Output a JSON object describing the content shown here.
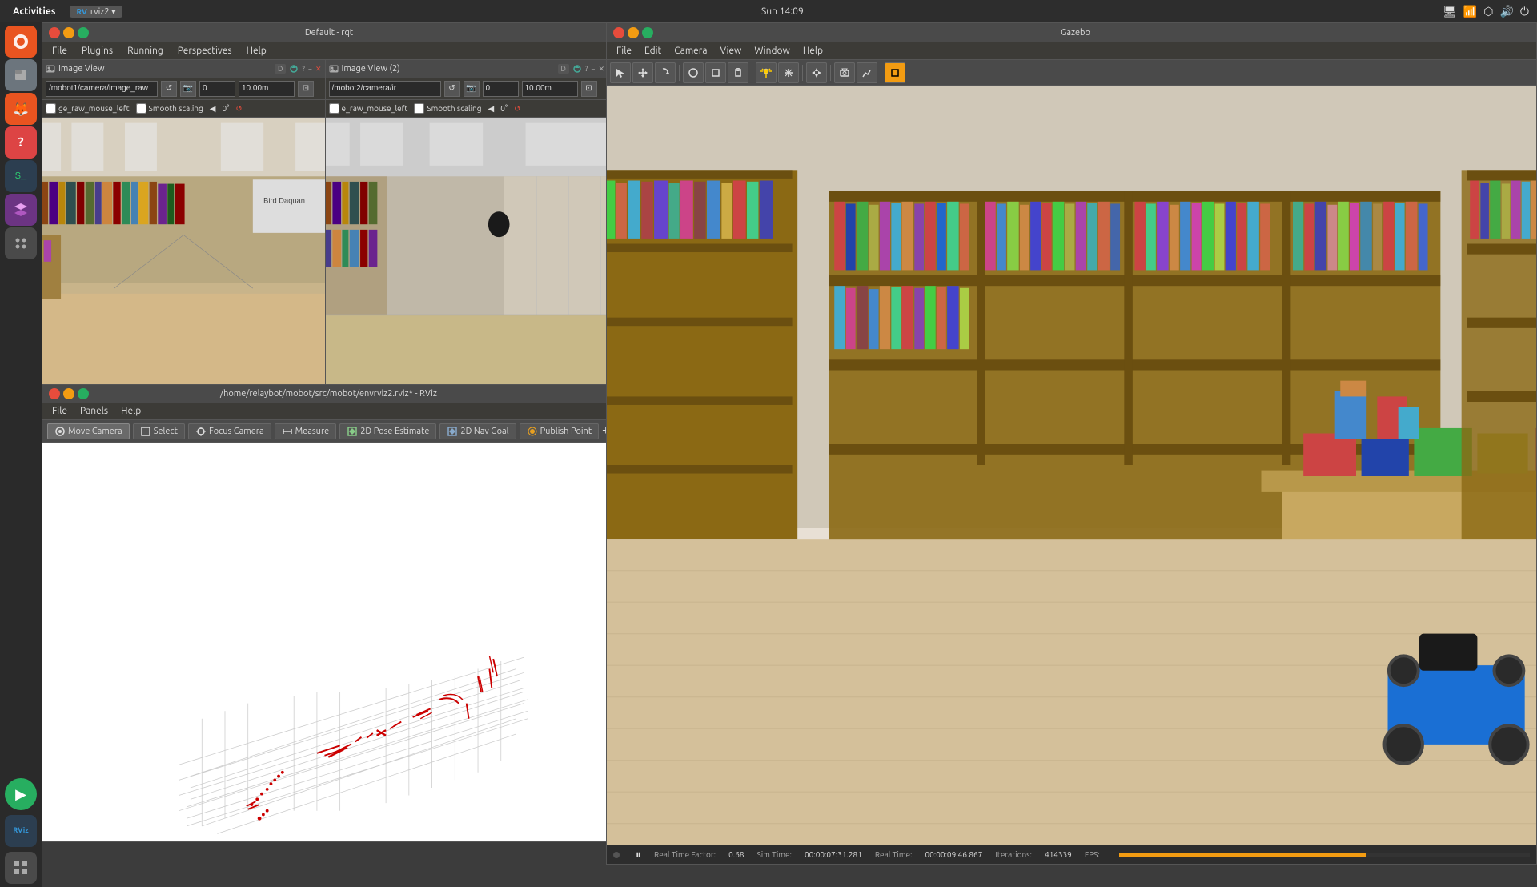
{
  "system": {
    "time": "Sun 14:09",
    "activities_label": "Activities"
  },
  "rqt_window": {
    "title": "Default - rqt",
    "menu": {
      "file": "File",
      "plugins": "Plugins",
      "running": "Running",
      "perspectives": "Perspectives",
      "help": "Help"
    },
    "image_view1": {
      "title": "Image View",
      "topic": "/mobot1/camera/image_raw",
      "zoom": "10.00m",
      "value": "0",
      "smooth_scaling": "Smooth scaling",
      "rotation": "0°"
    },
    "image_view2": {
      "title": "Image View (2)",
      "topic": "/mobot2/camera/ir",
      "zoom": "10.00m",
      "value": "0",
      "smooth_scaling": "Smooth scaling",
      "rotation": "0°"
    }
  },
  "rviz_window": {
    "title": "Gazebo",
    "menu": {
      "file": "File",
      "edit": "Edit",
      "camera": "Camera",
      "view": "View",
      "window": "Window",
      "help": "Help"
    },
    "status": {
      "real_time_factor_label": "Real Time Factor:",
      "real_time_factor": "0.68",
      "sim_time_label": "Sim Time:",
      "sim_time": "00:00:07:31.281",
      "real_time_label": "Real Time:",
      "real_time": "00:00:09:46.867",
      "iterations_label": "Iterations:",
      "iterations": "414339",
      "fps_label": "FPS:"
    }
  },
  "rviz2_window": {
    "title": "/home/relaybot/mobot/src/mobot/envrviz2.rviz* - RViz",
    "menu": {
      "file": "File",
      "panels": "Panels",
      "help": "Help"
    },
    "toolbar": {
      "move_camera": "Move Camera",
      "select": "Select",
      "focus_camera": "Focus Camera",
      "measure": "Measure",
      "pose_estimate": "2D Pose Estimate",
      "nav_goal": "2D Nav Goal",
      "publish_point": "Publish Point"
    }
  },
  "dock": {
    "items": [
      {
        "name": "ubuntu-icon",
        "label": "Ubuntu",
        "symbol": "⊙"
      },
      {
        "name": "files-icon",
        "label": "Files",
        "symbol": "📁"
      },
      {
        "name": "firefox-icon",
        "label": "Firefox",
        "symbol": "🔥"
      },
      {
        "name": "help-icon",
        "label": "Help",
        "symbol": "?"
      },
      {
        "name": "terminal-icon",
        "label": "Terminal",
        "symbol": ">_"
      },
      {
        "name": "layers-icon",
        "label": "Layers",
        "symbol": "⬡"
      },
      {
        "name": "apps-icon",
        "label": "Apps",
        "symbol": "⚙"
      },
      {
        "name": "play-icon",
        "label": "Play",
        "symbol": "▶"
      },
      {
        "name": "rviz-icon",
        "label": "RViz",
        "symbol": "RV"
      },
      {
        "name": "grid-icon",
        "label": "Grid",
        "symbol": "⊞"
      }
    ]
  },
  "colors": {
    "accent_orange": "#f39c12",
    "accent_blue": "#1a6fd4",
    "accent_red": "#e74c3c",
    "bg_dark": "#2d2d2d",
    "bg_panel": "#3c3b37",
    "bg_toolbar": "#4a4a4a"
  }
}
